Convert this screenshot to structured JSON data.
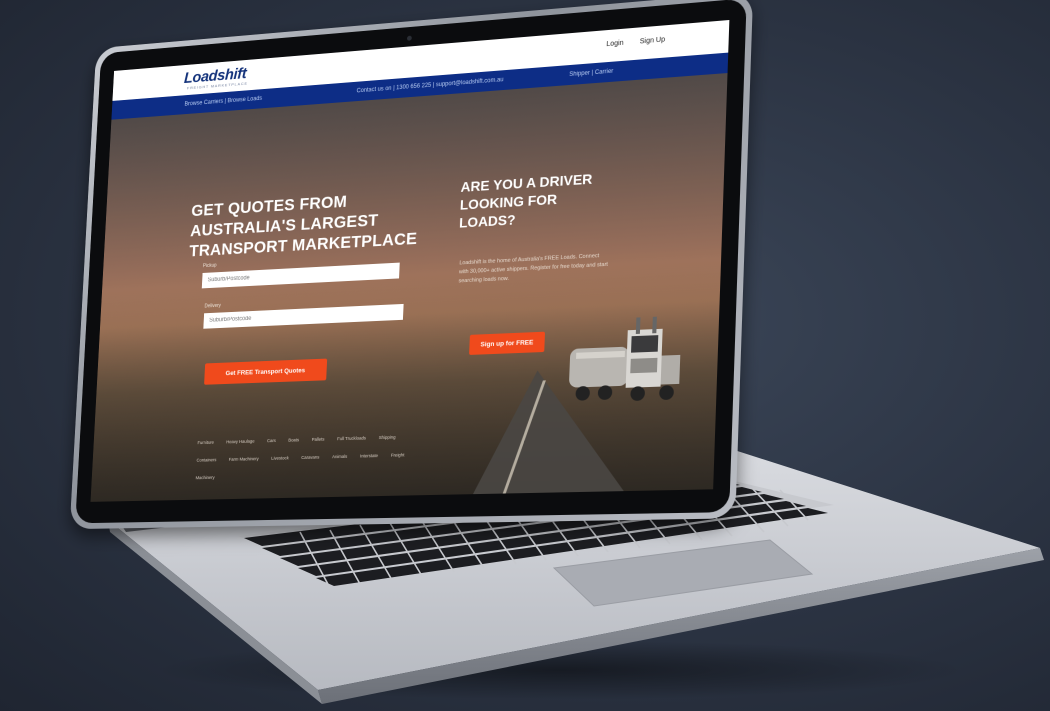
{
  "site": {
    "logo": "Loadshift",
    "logo_tagline": "FREIGHT MARKETPLACE",
    "header_links": [
      "Login",
      "Sign Up"
    ],
    "nav_left": "Browse Carriers  |  Browse Loads",
    "nav_center": "Contact us on  |  1300 656 225  |  support@loadshift.com.au",
    "nav_right": "Shipper  |  Carrier",
    "hero_title": "GET QUOTES FROM AUSTRALIA'S LARGEST TRANSPORT MARKETPLACE",
    "form": {
      "pickup_label": "Pickup",
      "pickup_placeholder": "Suburb/Postcode",
      "delivery_label": "Delivery",
      "delivery_placeholder": "Suburb/Postcode",
      "cta": "Get FREE Transport Quotes"
    },
    "driver_title": "ARE YOU A DRIVER LOOKING FOR LOADS?",
    "driver_text": "Loadshift is the home of Australia's FREE Loads. Connect with 30,000+ active shippers. Register for free today and start searching loads now.",
    "driver_cta": "Sign up for FREE",
    "category_links": [
      "Furniture",
      "Heavy Haulage",
      "Cars",
      "Boats",
      "Pallets",
      "Full Truckloads",
      "Shipping Containers",
      "Farm Machinery",
      "Livestock",
      "Caravans",
      "Animals",
      "Interstate",
      "Freight",
      "Machinery"
    ]
  }
}
